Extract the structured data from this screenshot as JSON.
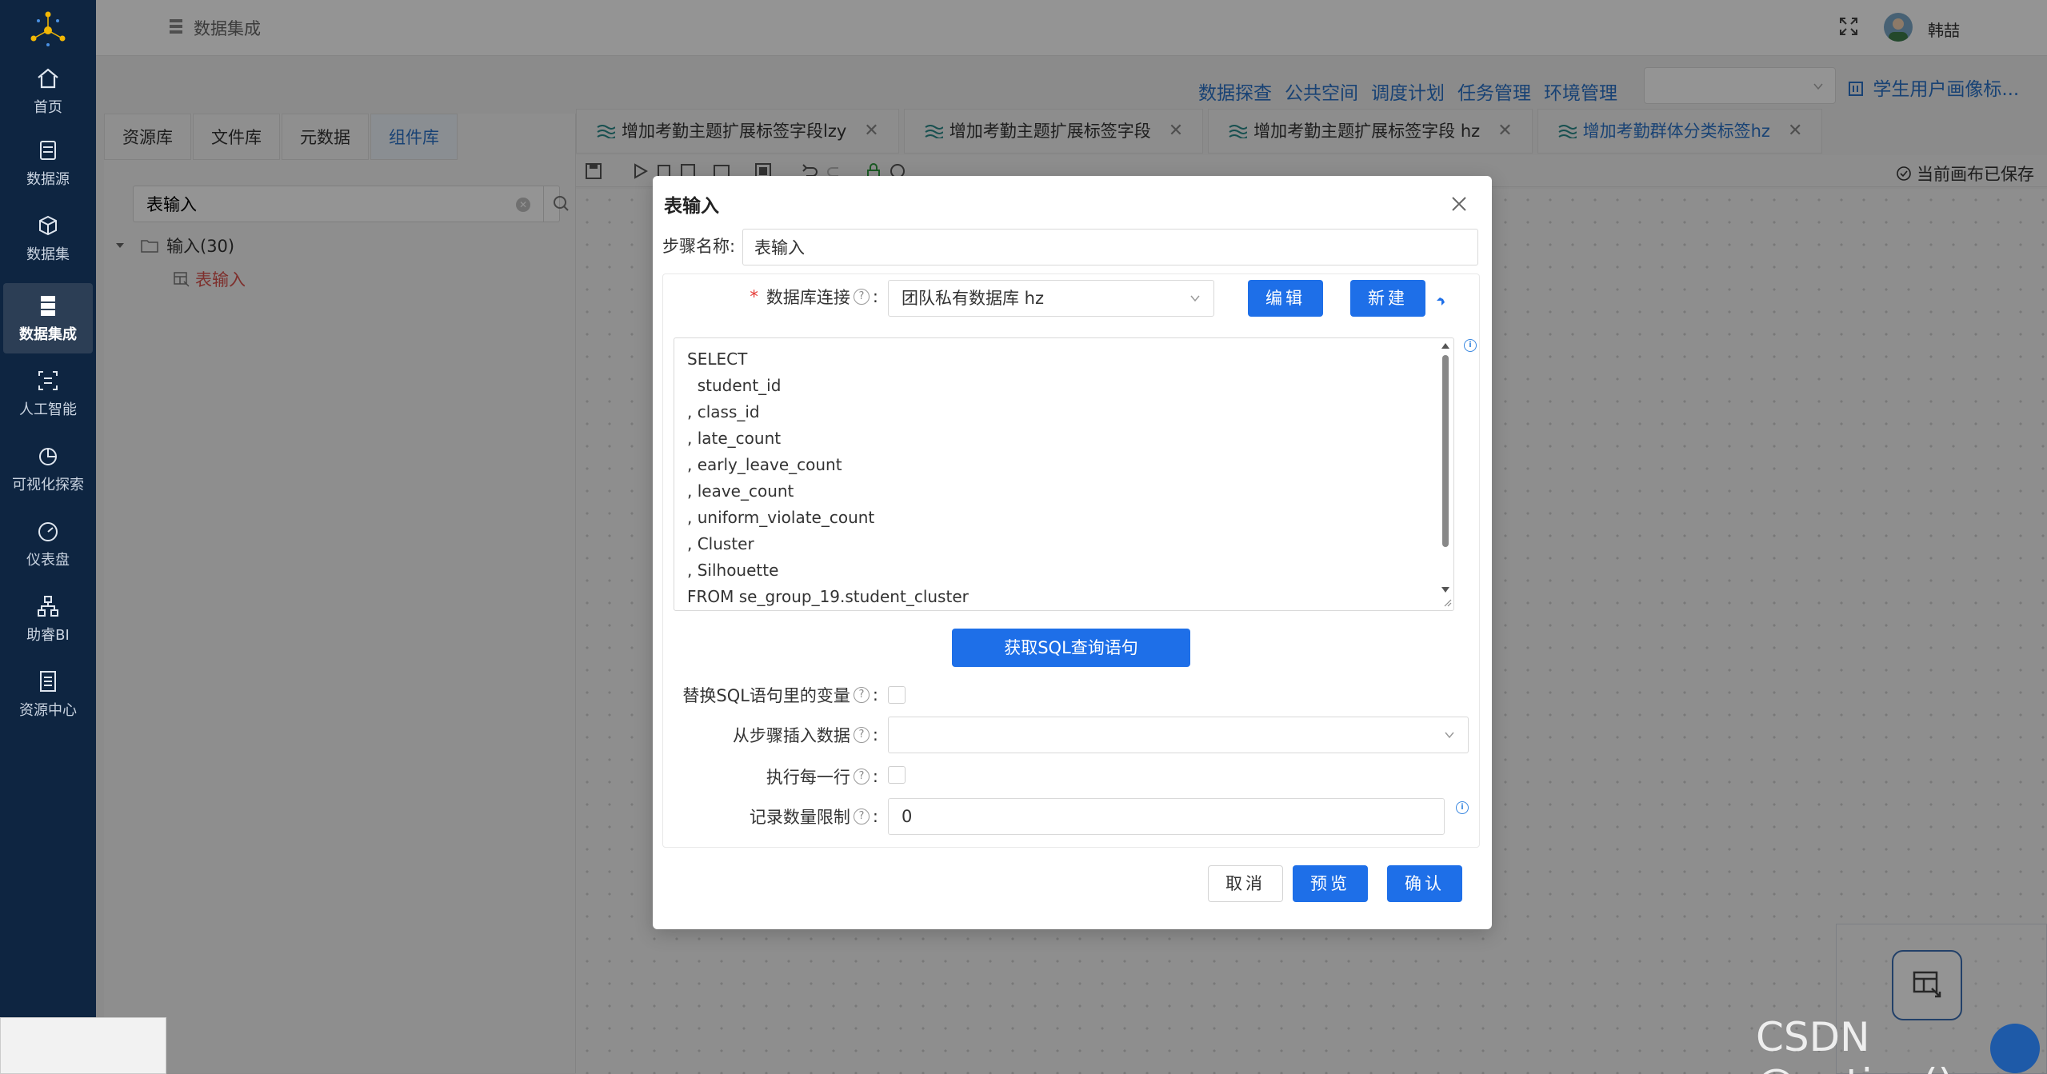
{
  "sidebar": {
    "items": [
      {
        "label": "首页",
        "icon": "home-icon"
      },
      {
        "label": "数据源",
        "icon": "database-icon"
      },
      {
        "label": "数据集",
        "icon": "cube-icon"
      },
      {
        "label": "数据集成",
        "icon": "server-icon"
      },
      {
        "label": "人工智能",
        "icon": "ai-icon"
      },
      {
        "label": "可视化探索",
        "icon": "pie-chart-icon"
      },
      {
        "label": "仪表盘",
        "icon": "gauge-icon"
      },
      {
        "label": "助睿BI",
        "icon": "org-chart-icon"
      },
      {
        "label": "资源中心",
        "icon": "document-icon"
      }
    ],
    "active": "数据集成"
  },
  "header": {
    "title": "数据集成",
    "username": "韩喆"
  },
  "top_links": [
    "数据探查",
    "公共空间",
    "调度计划",
    "任务管理",
    "环境管理"
  ],
  "env_select": {
    "value": ""
  },
  "project_link": "学生用户画像标...",
  "left_panel": {
    "tabs": [
      "资源库",
      "文件库",
      "元数据",
      "组件库"
    ],
    "active_tab": "组件库",
    "search_value": "表输入",
    "tree": {
      "root": "输入(30)",
      "child": "表输入"
    }
  },
  "work_tabs": [
    {
      "label": "增加考勤主题扩展标签字段lzy",
      "active": false
    },
    {
      "label": "增加考勤主题扩展标签字段",
      "active": false
    },
    {
      "label": "增加考勤主题扩展标签字段 hz",
      "active": false
    },
    {
      "label": "增加考勤群体分类标签hz",
      "active": true
    }
  ],
  "canvas_status": "当前画布已保存",
  "modal": {
    "title": "表输入",
    "step_name_label": "步骤名称:",
    "step_name_value": "表输入",
    "db_conn_label": "数据库连接",
    "db_conn_value": "团队私有数据库 hz",
    "edit_button": "编辑",
    "new_button": "新建",
    "sql_lines": [
      "SELECT",
      "  student_id",
      ", class_id",
      ", late_count",
      ", early_leave_count",
      ", leave_count",
      ", uniform_violate_count",
      ", Cluster",
      ", Silhouette",
      "FROM se_group_19.student_cluster"
    ],
    "get_sql_button": "获取SQL查询语句",
    "replace_var_label": "替换SQL语句里的变量",
    "insert_from_step_label": "从步骤插入数据",
    "insert_from_step_value": "",
    "exec_each_row_label": "执行每一行",
    "record_limit_label": "记录数量限制",
    "record_limit_value": "0",
    "cancel_button": "取消",
    "preview_button": "预览",
    "confirm_button": "确认"
  },
  "watermark": "CSDN @potion()",
  "colors": {
    "sidebar_bg": "#0e2541",
    "primary": "#1e6fe8",
    "link": "#2a72c8"
  }
}
